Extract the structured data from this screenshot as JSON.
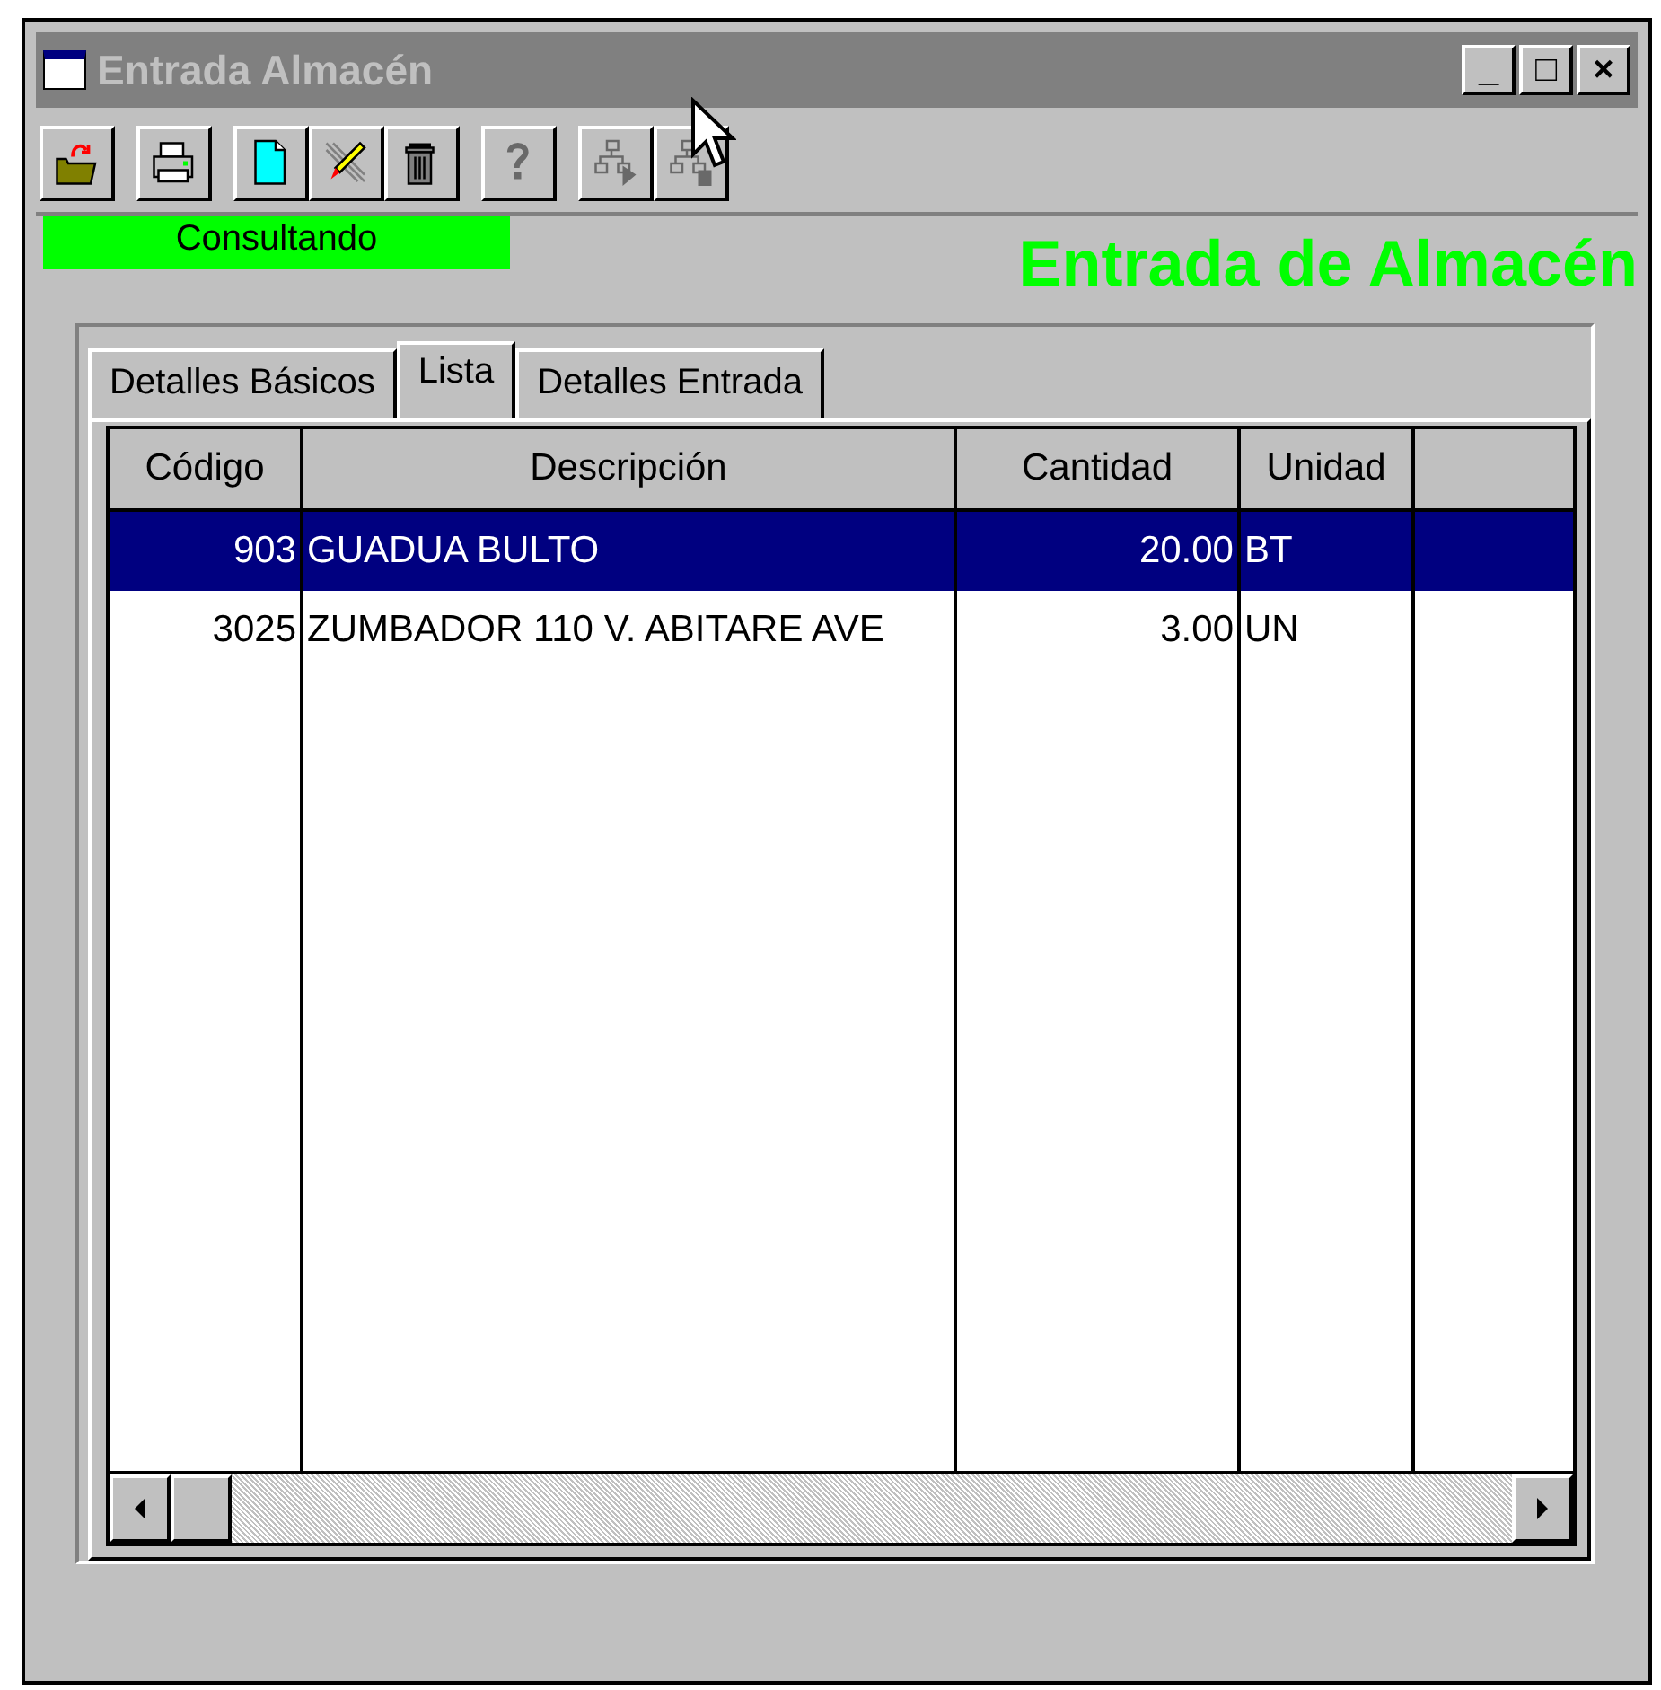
{
  "window": {
    "title": "Entrada Almacén",
    "controls": [
      "_",
      "□",
      "×"
    ]
  },
  "toolbar": [
    [
      {
        "kind": "open",
        "disabled": false
      }
    ],
    [
      {
        "kind": "print",
        "disabled": false
      }
    ],
    [
      {
        "kind": "new",
        "disabled": false
      },
      {
        "kind": "edit",
        "disabled": false
      },
      {
        "kind": "delete",
        "disabled": false
      }
    ],
    [
      {
        "kind": "help",
        "disabled": true
      }
    ],
    [
      {
        "kind": "tree-next",
        "disabled": true
      },
      {
        "kind": "tree-doc",
        "disabled": true
      }
    ]
  ],
  "status": "Consultando",
  "heading": "Entrada de Almacén",
  "tabs": [
    {
      "label": "Detalles Básicos",
      "selected": false
    },
    {
      "label": "Lista",
      "selected": true
    },
    {
      "label": "Detalles Entrada",
      "selected": false
    }
  ],
  "table": {
    "columns": [
      {
        "label": "Código"
      },
      {
        "label": "Descripción"
      },
      {
        "label": "Cantidad"
      },
      {
        "label": "Unidad"
      }
    ],
    "rows": [
      {
        "cells": [
          "903",
          "GUADUA BULTO",
          "20.00",
          "BT"
        ],
        "selected": true
      },
      {
        "cells": [
          "3025",
          "ZUMBADOR 110 V. ABITARE AVE",
          "3.00",
          "UN"
        ],
        "selected": false
      }
    ]
  }
}
